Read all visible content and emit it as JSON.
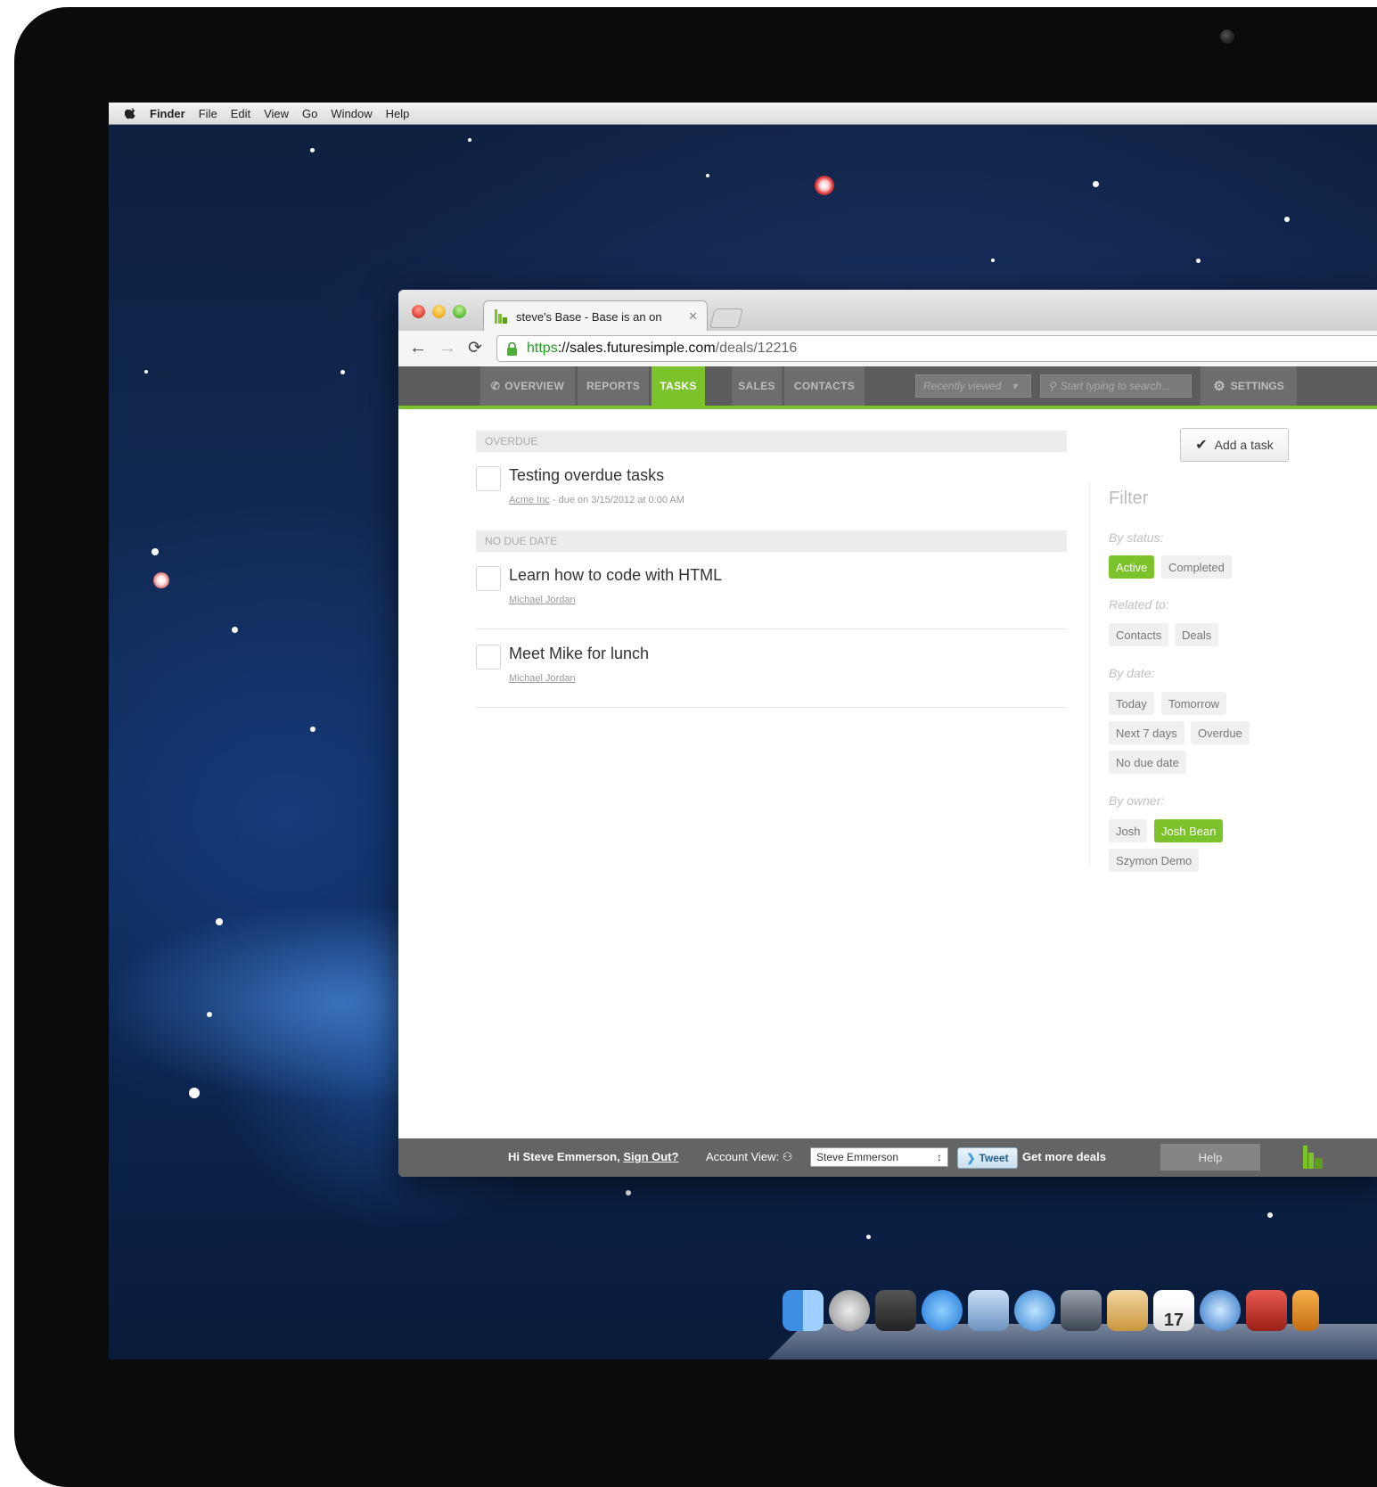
{
  "menubar": {
    "items": [
      "Finder",
      "File",
      "Edit",
      "View",
      "Go",
      "Window",
      "Help"
    ]
  },
  "browser": {
    "tab_title": "steve's Base - Base is an on",
    "url_scheme": "https",
    "url_host": "://sales.futuresimple.com",
    "url_path": "/deals/12216"
  },
  "appnav": {
    "tabs": [
      "OVERVIEW",
      "REPORTS",
      "TASKS",
      "SALES",
      "CONTACTS"
    ],
    "active_tab": "TASKS",
    "recently_viewed_placeholder": "Recently viewed",
    "search_placeholder": "Start typing to search...",
    "settings_label": "SETTINGS"
  },
  "tasks": {
    "sections": [
      {
        "header": "OVERDUE",
        "items": [
          {
            "title": "Testing overdue tasks",
            "link": "Acme Inc",
            "meta": " - due on 3/15/2012 at 0:00 AM"
          }
        ]
      },
      {
        "header": "NO DUE DATE",
        "items": [
          {
            "title": "Learn how to code with HTML",
            "link": "Michael Jordan",
            "meta": ""
          },
          {
            "title": "Meet Mike for lunch",
            "link": "Michael Jordan",
            "meta": ""
          }
        ]
      }
    ],
    "add_task_label": "Add a task"
  },
  "filter": {
    "title": "Filter",
    "status_label": "By status:",
    "status_options": [
      "Active",
      "Completed"
    ],
    "related_label": "Related to:",
    "related_options": [
      "Contacts",
      "Deals"
    ],
    "date_label": "By date:",
    "date_options": [
      "Today",
      "Tomorrow",
      "Next 7 days",
      "Overdue",
      "No due date"
    ],
    "owner_label": "By owner:",
    "owner_options": [
      "Josh",
      "Josh Bean",
      "Szymon Demo"
    ]
  },
  "footer": {
    "greeting": "Hi Steve Emmerson,",
    "sign_out": "Sign Out?",
    "account_view_label": "Account View:",
    "account_value": "Steve Emmerson",
    "tweet_label": "Tweet",
    "more_deals": "Get more deals",
    "help_label": "Help"
  },
  "dock": {
    "calendar_day": "17"
  },
  "colors": {
    "accent_green": "#7cc22b",
    "nav_gray": "#5c5c5c"
  }
}
